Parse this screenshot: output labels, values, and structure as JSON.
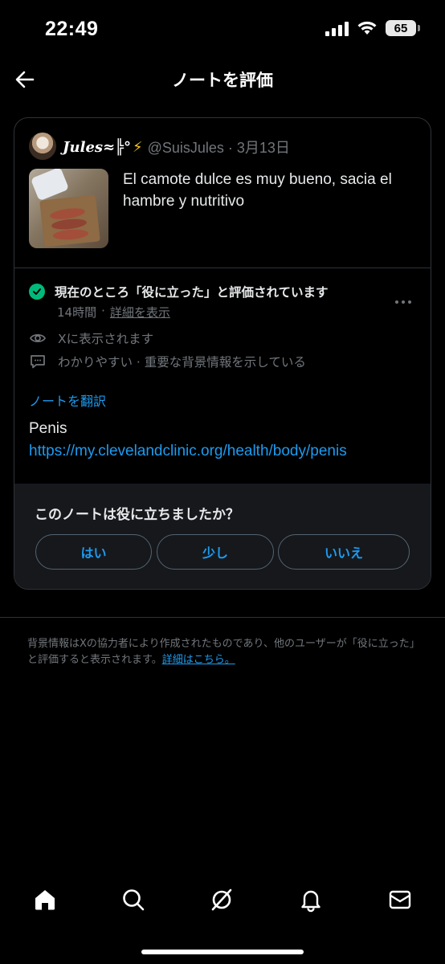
{
  "status_bar": {
    "time": "22:49",
    "battery": "65"
  },
  "nav": {
    "title": "ノートを評価",
    "back_icon": "arrow-left-icon"
  },
  "post": {
    "author_name": "Jules≈╠°",
    "author_emoji": "⚡",
    "handle_date": "@SuisJules · 3月13日",
    "text": "El camote dulce es muy bueno, sacia el hambre y nutritivo"
  },
  "note": {
    "status_label": "現在のところ「役に立った」と評価されています",
    "time_ago": "14時間",
    "separator": "·",
    "details_link": "詳細を表示",
    "visibility": "Xに表示されます",
    "reasons": "わかりやすい · 重要な背景情報を示している",
    "translate_link": "ノートを翻訳",
    "body_text": "Penis",
    "body_link": "https://my.clevelandclinic.org/health/body/penis"
  },
  "rating": {
    "question": "このノートは役に立ちましたか？",
    "options": [
      "はい",
      "少し",
      "いいえ"
    ]
  },
  "footnote": {
    "text": "背景情報はXの協力者により作成されたものであり、他のユーザーが「役に立った」と評価すると表示されます。",
    "link": "詳細はこちら。"
  },
  "tab_bar": {
    "tabs": [
      "home-icon",
      "search-icon",
      "grok-icon",
      "notifications-bell-icon",
      "messages-envelope-icon"
    ]
  },
  "colors": {
    "accent": "#1d9bf0",
    "success": "#00ba7c",
    "muted": "#71767b",
    "border": "#2f3336",
    "background": "#000000"
  }
}
